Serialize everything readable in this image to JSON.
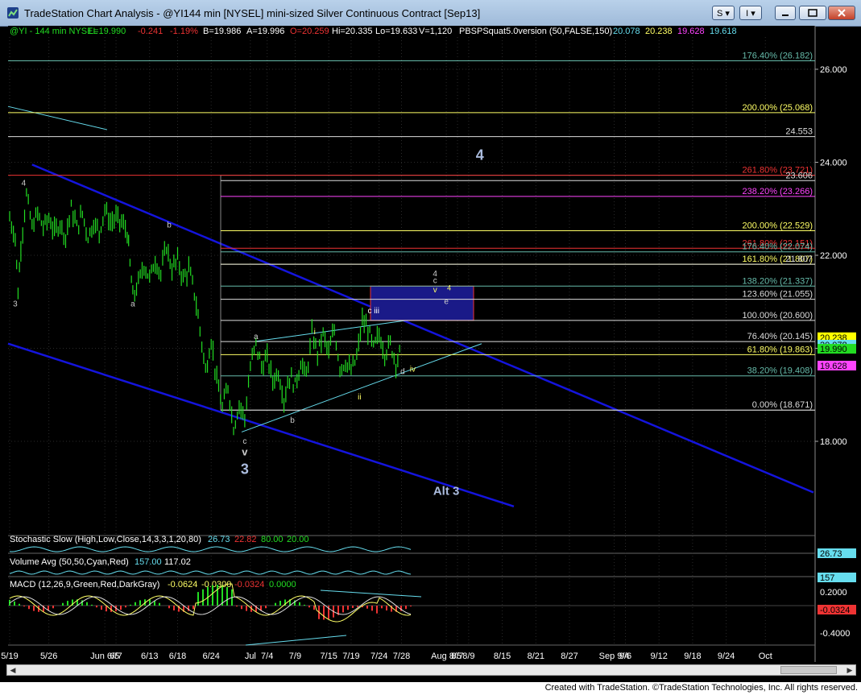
{
  "window": {
    "title": "TradeStation Chart Analysis - @YI144 min [NYSEL] mini-sized Silver Continuous Contract [Sep13]",
    "btn_s": "S ▾",
    "btn_i": "I ▾",
    "footer": "Created with TradeStation. ©TradeStation Technologies, Inc. All rights reserved."
  },
  "colors": {
    "background": "#000000",
    "price_bars": "#22dd22",
    "channel": "#1414dd",
    "cyan": "#66ddee",
    "fib_yellow": "#ffff66",
    "fib_red": "#ee3333",
    "fib_magenta": "#ff44ff",
    "fib_white": "#dddddd",
    "fib_teal": "#66bbaa"
  },
  "header": {
    "symbol": "@YI - 144 min  NYSEL",
    "last": "L=19.990",
    "change": "-0.241",
    "change_pct": "-1.19%",
    "bid": "B=19.986",
    "ask": "A=19.996",
    "open": "O=20.259",
    "high": "Hi=20.335",
    "low": "Lo=19.633",
    "volume": "V=1,120",
    "study": "PBSPSquat5.0version (50,FALSE,150)",
    "study_v1": "20.078",
    "study_v2": "20.238",
    "study_v3": "19.628",
    "study_v4": "19.618"
  },
  "chart_data": {
    "type": "bar",
    "symbol": "@YI",
    "interval": "144 min",
    "ylim": [
      16.6,
      27.0
    ],
    "y_ticks": [
      {
        "value": 18.0,
        "label": "18.000"
      },
      {
        "value": 20.0,
        "label": "20.000"
      },
      {
        "value": 22.0,
        "label": "22.000"
      },
      {
        "value": 24.0,
        "label": "24.000"
      },
      {
        "value": 26.0,
        "label": "26.000"
      }
    ],
    "x_ticks": [
      "5/19",
      "5/26",
      "Jun 6/5",
      "6/7",
      "6/13",
      "6/18",
      "6/24",
      "Jul",
      "7/4",
      "7/9",
      "7/15",
      "7/19",
      "7/24",
      "7/28",
      "Aug 8/5",
      "8/7",
      "8/9",
      "8/15",
      "8/21",
      "8/27",
      "Sep 9/4",
      "9/6",
      "9/12",
      "9/18",
      "9/24",
      "Oct"
    ],
    "x_tick_days": [
      0,
      7,
      17,
      19,
      25,
      30,
      36,
      43,
      46,
      51,
      57,
      61,
      66,
      70,
      78,
      80,
      82,
      88,
      94,
      100,
      108,
      110,
      116,
      122,
      128,
      135
    ],
    "price_path": [
      [
        0,
        22.8
      ],
      [
        1,
        22.4
      ],
      [
        1.5,
        21.2
      ],
      [
        2,
        22.2
      ],
      [
        3,
        23.3
      ],
      [
        4,
        22.6
      ],
      [
        5,
        22.9
      ],
      [
        6,
        22.6
      ],
      [
        7,
        22.8
      ],
      [
        8,
        22.5
      ],
      [
        9,
        22.7
      ],
      [
        10,
        22.4
      ],
      [
        11,
        23.0
      ],
      [
        12,
        22.6
      ],
      [
        13,
        22.9
      ],
      [
        14,
        22.4
      ],
      [
        15,
        22.7
      ],
      [
        16,
        22.5
      ],
      [
        17,
        23.0
      ],
      [
        18,
        22.7
      ],
      [
        19,
        22.8
      ],
      [
        20,
        22.7
      ],
      [
        21,
        22.5
      ],
      [
        21.5,
        21.8
      ],
      [
        22,
        21.1
      ],
      [
        23,
        21.4
      ],
      [
        24,
        21.8
      ],
      [
        25,
        21.5
      ],
      [
        26,
        21.9
      ],
      [
        27,
        21.6
      ],
      [
        28,
        22.2
      ],
      [
        29,
        21.7
      ],
      [
        30,
        21.9
      ],
      [
        31,
        21.5
      ],
      [
        32,
        21.7
      ],
      [
        33,
        21.2
      ],
      [
        34,
        20.4
      ],
      [
        35,
        19.5
      ],
      [
        36,
        20.2
      ],
      [
        37,
        19.3
      ],
      [
        38,
        18.7
      ],
      [
        39,
        19.2
      ],
      [
        40,
        18.3
      ],
      [
        41,
        18.8
      ],
      [
        42,
        18.5
      ],
      [
        43,
        19.6
      ],
      [
        44,
        20.1
      ],
      [
        45,
        19.6
      ],
      [
        46,
        19.8
      ],
      [
        47,
        19.3
      ],
      [
        48,
        19.5
      ],
      [
        49,
        18.9
      ],
      [
        50,
        19.4
      ],
      [
        51,
        19.2
      ],
      [
        52,
        19.7
      ],
      [
        53,
        19.4
      ],
      [
        54,
        20.3
      ],
      [
        55,
        19.9
      ],
      [
        56,
        20.3
      ],
      [
        57,
        19.9
      ],
      [
        58,
        20.4
      ],
      [
        59,
        19.6
      ],
      [
        60,
        19.7
      ],
      [
        61,
        19.5
      ],
      [
        62,
        19.8
      ],
      [
        63,
        20.6
      ],
      [
        64,
        20.4
      ],
      [
        65,
        20.0
      ],
      [
        66,
        20.3
      ],
      [
        67,
        19.9
      ],
      [
        68,
        20.1
      ],
      [
        69,
        19.7
      ],
      [
        70,
        19.99
      ]
    ],
    "fib_levels": [
      {
        "value": 26.182,
        "label": "176.40% (26.182)",
        "color": "#66bbaa"
      },
      {
        "value": 25.068,
        "label": "200.00% (25.068)",
        "color": "#ffff66"
      },
      {
        "value": 24.553,
        "label": "24.553",
        "color": "#dddddd"
      },
      {
        "value": 23.721,
        "label": "261.80% (23.721)",
        "color": "#ee3333"
      },
      {
        "value": 23.606,
        "label": "23.606",
        "color": "#dddddd"
      },
      {
        "value": 23.266,
        "label": "238.20% (23.266)",
        "color": "#ff44ff"
      },
      {
        "value": 22.529,
        "label": "200.00% (22.529)",
        "color": "#ffff66"
      },
      {
        "value": 22.151,
        "label": "261.80% (22.151)",
        "color": "#ee3333"
      },
      {
        "value": 22.074,
        "label": "176.40% (22.074)",
        "color": "#66bbaa"
      },
      {
        "value": 21.807,
        "label": "161.80% (21.807)",
        "color": "#ffff66"
      },
      {
        "value": 21.807,
        "label": "21.807",
        "color": "#dddddd"
      },
      {
        "value": 21.337,
        "label": "138.20% (21.337)",
        "color": "#66bbaa"
      },
      {
        "value": 21.055,
        "label": "123.60% (21.055)",
        "color": "#dddddd"
      },
      {
        "value": 20.6,
        "label": "100.00% (20.600)",
        "color": "#dddddd"
      },
      {
        "value": 20.145,
        "label": "76.40% (20.145)",
        "color": "#dddddd"
      },
      {
        "value": 19.863,
        "label": "61.80% (19.863)",
        "color": "#ffff66"
      },
      {
        "value": 19.408,
        "label": "38.20% (19.408)",
        "color": "#66bbaa"
      },
      {
        "value": 18.671,
        "label": "0.00% (18.671)",
        "color": "#dddddd"
      }
    ],
    "price_markers": [
      {
        "value": 20.238,
        "label": "20.238",
        "bg": "#ffff00",
        "fg": "#000000"
      },
      {
        "value": 20.078,
        "label": "20.078",
        "bg": "#66ddee",
        "fg": "#000000"
      },
      {
        "value": 19.99,
        "label": "19.990",
        "bg": "#22dd22",
        "fg": "#000000"
      },
      {
        "value": 19.628,
        "label": "19.628",
        "bg": "#ff44ff",
        "fg": "#000000"
      }
    ],
    "wave_labels": [
      {
        "text": "4",
        "x": 2.5,
        "y": 23.5,
        "color": "#cccccc",
        "size": 10
      },
      {
        "text": "3",
        "x": 1,
        "y": 20.9,
        "color": "#cccccc",
        "size": 10
      },
      {
        "text": "b",
        "x": 28.5,
        "y": 22.6,
        "color": "#cccccc",
        "size": 10
      },
      {
        "text": "a",
        "x": 22,
        "y": 20.9,
        "color": "#cccccc",
        "size": 10
      },
      {
        "text": "a",
        "x": 44,
        "y": 20.2,
        "color": "#cccccc",
        "size": 10
      },
      {
        "text": "b",
        "x": 50.5,
        "y": 18.4,
        "color": "#cccccc",
        "size": 10
      },
      {
        "text": "c",
        "x": 42,
        "y": 17.95,
        "color": "#cccccc",
        "size": 10
      },
      {
        "text": "v",
        "x": 42,
        "y": 17.7,
        "color": "#cccccc",
        "size": 13
      },
      {
        "text": "3",
        "x": 42,
        "y": 17.3,
        "color": "#aabbdd",
        "size": 18
      },
      {
        "text": "i",
        "x": 54.5,
        "y": 20.3,
        "color": "#ffff66",
        "size": 10
      },
      {
        "text": "ii",
        "x": 62.5,
        "y": 18.9,
        "color": "#ffff66",
        "size": 10
      },
      {
        "text": "c iii",
        "x": 65,
        "y": 20.75,
        "color": "#ffffff",
        "size": 10
      },
      {
        "text": "iv",
        "x": 72,
        "y": 19.5,
        "color": "#ffff66",
        "size": 10
      },
      {
        "text": "d",
        "x": 70.2,
        "y": 19.45,
        "color": "#cccccc",
        "size": 10
      },
      {
        "text": "4",
        "x": 76,
        "y": 21.55,
        "color": "#cccccc",
        "size": 10
      },
      {
        "text": "c",
        "x": 76,
        "y": 21.4,
        "color": "#cccccc",
        "size": 10
      },
      {
        "text": "v",
        "x": 76,
        "y": 21.2,
        "color": "#ffff66",
        "size": 10
      },
      {
        "text": "4",
        "x": 78.5,
        "y": 21.25,
        "color": "#ffff66",
        "size": 9
      },
      {
        "text": "e",
        "x": 78,
        "y": 20.95,
        "color": "#cccccc",
        "size": 10
      },
      {
        "text": "4",
        "x": 84,
        "y": 24.05,
        "color": "#aabbdd",
        "size": 18
      },
      {
        "text": "Alt 3",
        "x": 78,
        "y": 16.85,
        "color": "#aabbdd",
        "size": 15
      }
    ]
  },
  "indicators": {
    "stochastic": {
      "label": "Stochastic Slow (High,Low,Close,14,3,3,1,20,80)",
      "v1": "26.73",
      "v2": "22.82",
      "v3": "80.00",
      "v4": "20.00",
      "axis": "26.73"
    },
    "volume": {
      "label": "Volume Avg (50,50,Cyan,Red)",
      "v1": "157.00",
      "v2": "117.02",
      "axis": "157"
    },
    "macd": {
      "label": "MACD (12,26,9,Green,Red,DarkGray)",
      "v1": "-0.0624",
      "v2": "-0.0300",
      "v3": "-0.0324",
      "v4": "0.0000",
      "axis_top": "0.2000",
      "axis_mid": "-0.0324",
      "axis_bot": "-0.4000"
    }
  }
}
